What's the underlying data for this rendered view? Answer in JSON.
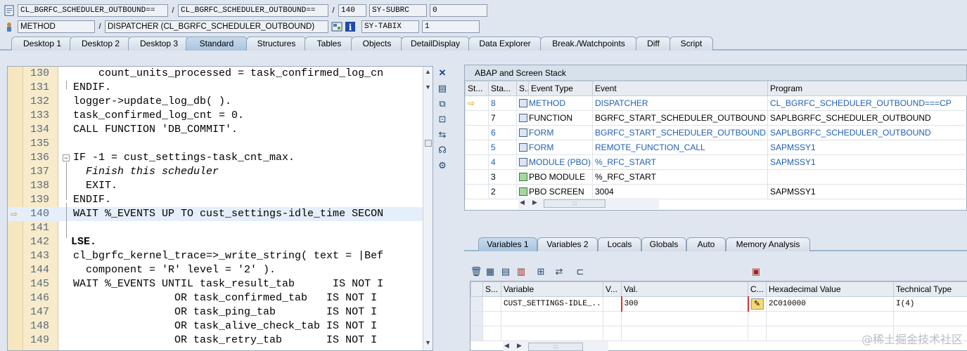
{
  "header": {
    "row1": {
      "program": "CL_BGRFC_SCHEDULER_OUTBOUND==",
      "include": "CL_BGRFC_SCHEDULER_OUTBOUND==",
      "line": "140",
      "sysvar_name": "SY-SUBRC",
      "sysvar_value": "0"
    },
    "row2": {
      "kind": "METHOD",
      "event": "DISPATCHER (CL_BGRFC_SCHEDULER_OUTBOUND)",
      "sysvar_name": "SY-TABIX",
      "sysvar_value": "1"
    },
    "separator": "/"
  },
  "tabs": [
    {
      "label": "Desktop 1",
      "active": false
    },
    {
      "label": "Desktop 2",
      "active": false
    },
    {
      "label": "Desktop 3",
      "active": false
    },
    {
      "label": "Standard",
      "active": true
    },
    {
      "label": "Structures",
      "active": false
    },
    {
      "label": "Tables",
      "active": false
    },
    {
      "label": "Objects",
      "active": false
    },
    {
      "label": "DetailDisplay",
      "active": false
    },
    {
      "label": "Data Explorer",
      "active": false
    },
    {
      "label": "Break./Watchpoints",
      "active": false
    },
    {
      "label": "Diff",
      "active": false
    },
    {
      "label": "Script",
      "active": false
    }
  ],
  "editor": {
    "current_line": 140,
    "lines": [
      {
        "n": "130",
        "t": "     count_units_processed = task_confirmed_log_cn"
      },
      {
        "n": "131",
        "t": " ENDIF."
      },
      {
        "n": "132",
        "t": " logger->update_log_db( )."
      },
      {
        "n": "133",
        "t": " task_confirmed_log_cnt = 0."
      },
      {
        "n": "134",
        "t": " CALL FUNCTION 'DB_COMMIT'."
      },
      {
        "n": "135",
        "t": ""
      },
      {
        "n": "136",
        "t": " IF -1 = cust_settings-task_cnt_max."
      },
      {
        "n": "137",
        "t": "   Finish this scheduler"
      },
      {
        "n": "138",
        "t": "   EXIT."
      },
      {
        "n": "139",
        "t": " ENDIF."
      },
      {
        "n": "140",
        "t": " WAIT %_EVENTS UP TO cust_settings-idle_time SECON"
      },
      {
        "n": "141",
        "t": ""
      },
      {
        "n": "142",
        "t": "LSE."
      },
      {
        "n": "143",
        "t": " cl_bgrfc_kernel_trace=>_write_string( text = |Bef"
      },
      {
        "n": "144",
        "t": "   component = 'R' level = '2' )."
      },
      {
        "n": "145",
        "t": " WAIT %_EVENTS UNTIL task_result_tab      IS NOT I"
      },
      {
        "n": "146",
        "t": "                 OR task_confirmed_tab   IS NOT I"
      },
      {
        "n": "147",
        "t": "                 OR task_ping_tab        IS NOT I"
      },
      {
        "n": "148",
        "t": "                 OR task_alive_check_tab IS NOT I"
      },
      {
        "n": "149",
        "t": "                 OR task_retry_tab       IS NOT I"
      }
    ]
  },
  "stack": {
    "title": "ABAP and Screen Stack",
    "columns": [
      "St...",
      "Sta...",
      "S...",
      "Event Type",
      "Event",
      "Program"
    ],
    "rows": [
      {
        "current": true,
        "level": "8",
        "type": "METHOD",
        "event": "DISPATCHER",
        "program": "CL_BGRFC_SCHEDULER_OUTBOUND===CP",
        "link": true,
        "icon": "blue"
      },
      {
        "current": false,
        "level": "7",
        "type": "FUNCTION",
        "event": "BGRFC_START_SCHEDULER_OUTBOUND",
        "program": "SAPLBGRFC_SCHEDULER_OUTBOUND",
        "link": false,
        "icon": "blue"
      },
      {
        "current": false,
        "level": "6",
        "type": "FORM",
        "event": "BGRFC_START_SCHEDULER_OUTBOUND",
        "program": "SAPLBGRFC_SCHEDULER_OUTBOUND",
        "link": true,
        "icon": "blue"
      },
      {
        "current": false,
        "level": "5",
        "type": "FORM",
        "event": "REMOTE_FUNCTION_CALL",
        "program": "SAPMSSY1",
        "link": true,
        "icon": "blue"
      },
      {
        "current": false,
        "level": "4",
        "type": "MODULE (PBO)",
        "event": "%_RFC_START",
        "program": "SAPMSSY1",
        "link": true,
        "icon": "blue"
      },
      {
        "current": false,
        "level": "3",
        "type": "PBO MODULE",
        "event": "%_RFC_START",
        "program": "",
        "link": false,
        "icon": "green"
      },
      {
        "current": false,
        "level": "2",
        "type": "PBO SCREEN",
        "event": "3004",
        "program": "SAPMSSY1",
        "link": false,
        "icon": "green"
      }
    ]
  },
  "var_tabs": [
    {
      "label": "Variables 1",
      "active": true
    },
    {
      "label": "Variables 2",
      "active": false
    },
    {
      "label": "Locals",
      "active": false
    },
    {
      "label": "Globals",
      "active": false
    },
    {
      "label": "Auto",
      "active": false
    },
    {
      "label": "Memory Analysis",
      "active": false
    }
  ],
  "variables": {
    "columns": [
      "S...",
      "Variable",
      "V...",
      "Val.",
      "C...",
      "Hexadecimal Value",
      "Technical Type"
    ],
    "rows": [
      {
        "variable": "CUST_SETTINGS-IDLE_...",
        "value": "300",
        "hex": "2C010000",
        "type": "I(4)"
      }
    ]
  },
  "watermark": "@稀土掘金技术社区"
}
